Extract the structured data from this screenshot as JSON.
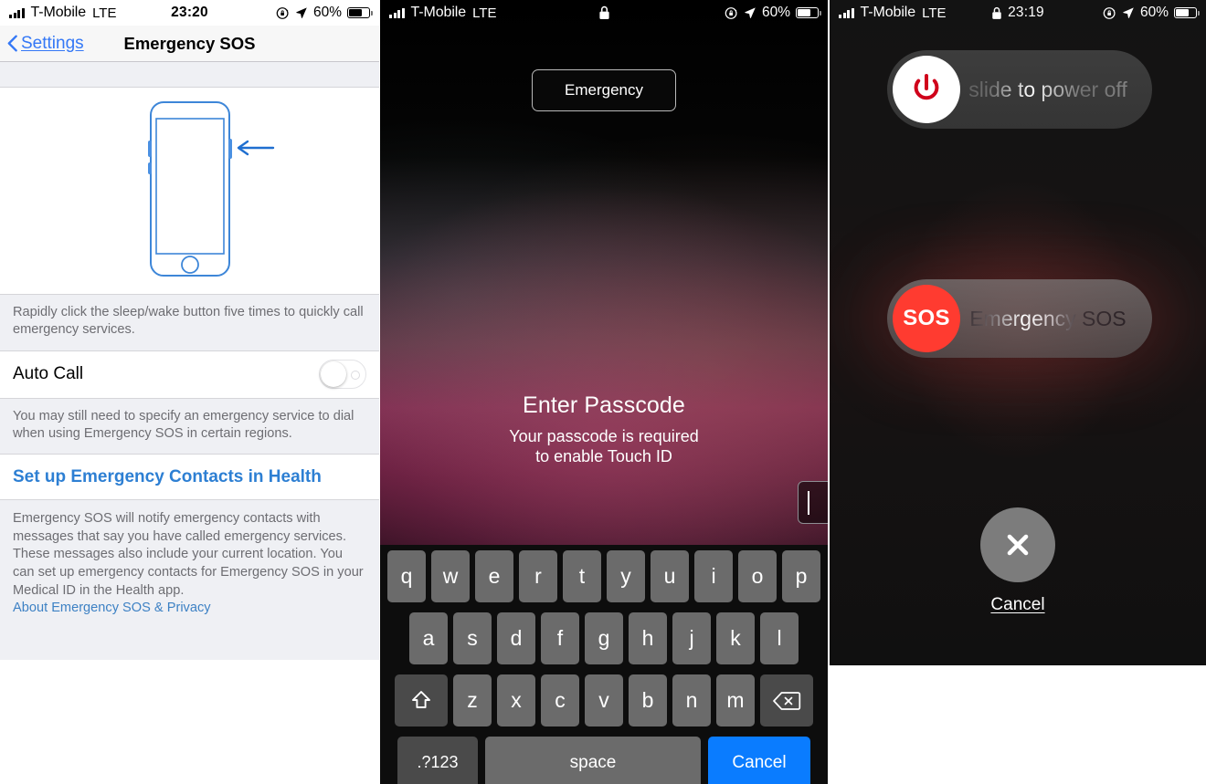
{
  "panels": {
    "settings": {
      "status_bar": {
        "carrier": "T-Mobile",
        "network": "LTE",
        "time": "23:20",
        "battery_percent": "60%",
        "battery_level": 60,
        "icons": [
          "signal-bars-icon",
          "rotation-lock-icon",
          "location-arrow-icon",
          "battery-icon"
        ]
      },
      "nav": {
        "back_label": "Settings",
        "title": "Emergency SOS"
      },
      "illustration": {
        "name": "iphone-side-button-illustration",
        "accent_color": "#3478f6"
      },
      "caption": "Rapidly click the sleep/wake button five times to quickly call emergency services.",
      "auto_call": {
        "label": "Auto Call",
        "value": "off"
      },
      "auto_call_note": "You may still need to specify an emergency service to dial when using Emergency SOS in certain regions.",
      "health_link": "Set up Emergency Contacts in Health",
      "footer_note": "Emergency SOS will notify emergency contacts with messages that say you have called emergency services. These messages also include your current location. You can set up emergency contacts for Emergency SOS in your Medical ID in the Health app.",
      "privacy_link": "About Emergency SOS & Privacy"
    },
    "lockscreen": {
      "status_bar": {
        "carrier": "T-Mobile",
        "network": "LTE",
        "time": "",
        "battery_percent": "60%",
        "battery_level": 60,
        "icons": [
          "signal-bars-icon",
          "lock-icon",
          "rotation-lock-icon",
          "location-arrow-icon",
          "battery-icon"
        ]
      },
      "emergency_button": "Emergency",
      "passcode_title": "Enter Passcode",
      "passcode_subtitle_line1": "Your passcode is required",
      "passcode_subtitle_line2": "to enable Touch ID",
      "passcode_value": "",
      "keyboard": {
        "row1": [
          "q",
          "w",
          "e",
          "r",
          "t",
          "y",
          "u",
          "i",
          "o",
          "p"
        ],
        "row2": [
          "a",
          "s",
          "d",
          "f",
          "g",
          "h",
          "j",
          "k",
          "l"
        ],
        "row3": [
          "z",
          "x",
          "c",
          "v",
          "b",
          "n",
          "m"
        ],
        "shift_key": "shift-icon",
        "backspace_key": "backspace-icon",
        "numbers_key": ".?123",
        "space_key": "space",
        "cancel_key": "Cancel",
        "cancel_color": "#0a7cff"
      }
    },
    "poweroff": {
      "status_bar": {
        "carrier": "T-Mobile",
        "network": "LTE",
        "time": "23:19",
        "battery_percent": "60%",
        "battery_level": 60,
        "icons": [
          "signal-bars-icon",
          "lock-icon",
          "rotation-lock-icon",
          "location-arrow-icon",
          "battery-icon"
        ]
      },
      "power_slider": {
        "text": "slide to power off",
        "knob_icon": "power-icon",
        "knob_color": "#d0021b"
      },
      "sos_slider": {
        "text": "Emergency SOS",
        "knob_label": "SOS",
        "knob_color": "#ff3b30"
      },
      "cancel": {
        "icon": "close-x-icon",
        "label": "Cancel"
      }
    }
  }
}
